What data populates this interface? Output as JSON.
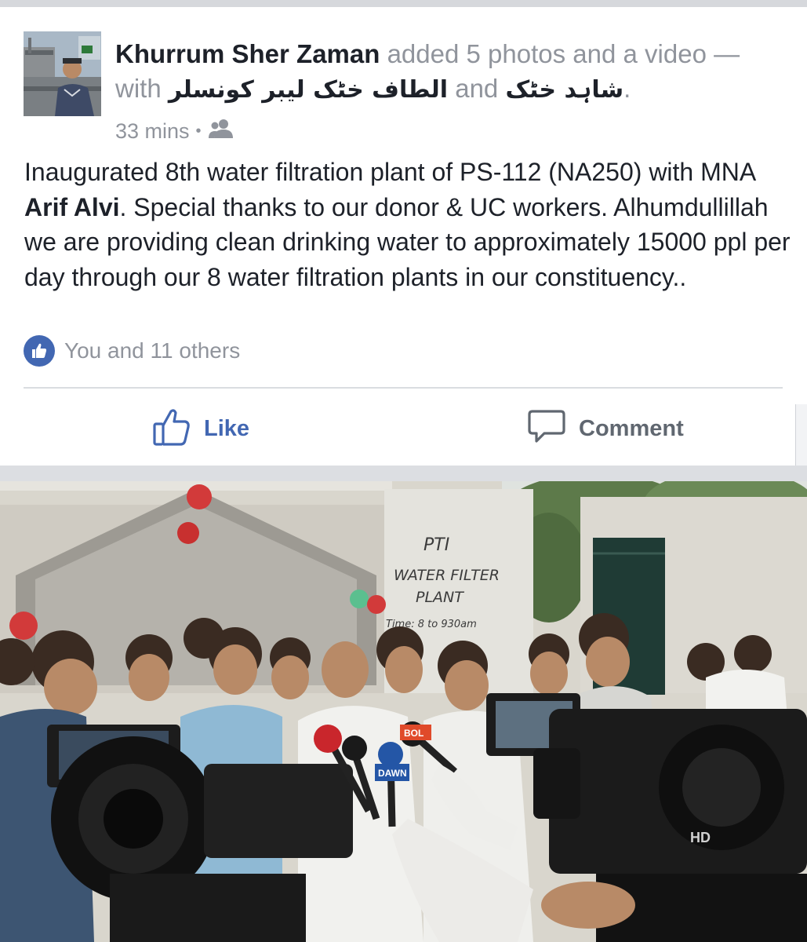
{
  "post": {
    "author": "Khurrum Sher Zaman",
    "action": " added 5 photos and a video — with ",
    "tagged_1": "الطاف خٹک لیبر کونسلر",
    "conjunction": " and ",
    "tagged_2": "شاہد خٹک",
    "end_punct": ".",
    "time": "33 mins",
    "audience_icon": "friends-icon",
    "text_part1": "Inaugurated 8th water filtration plant of PS-112 (NA250) with MNA ",
    "text_bold": "Arif Alvi",
    "text_part2": ". Special thanks to our donor & UC workers. Alhumdullillah we are providing clean drinking water to approximately 15000 ppl per day through our 8 water filtration plants in our constituency..",
    "reactions": "You and 11 others"
  },
  "actions": {
    "like_label": "Like",
    "comment_label": "Comment"
  },
  "photo": {
    "sign_line1": "PTI",
    "sign_line2": "WATER FILTER",
    "sign_line3": "PLANT",
    "sign_line4": "Time: 8 to 930am",
    "camera_brand": "HD",
    "mic_flag_1": "DAWN",
    "mic_flag_2": "BOL"
  },
  "colors": {
    "accent": "#4267b2",
    "text": "#1d2129",
    "secondary_text": "#90949c",
    "background": "#e9ebee"
  }
}
